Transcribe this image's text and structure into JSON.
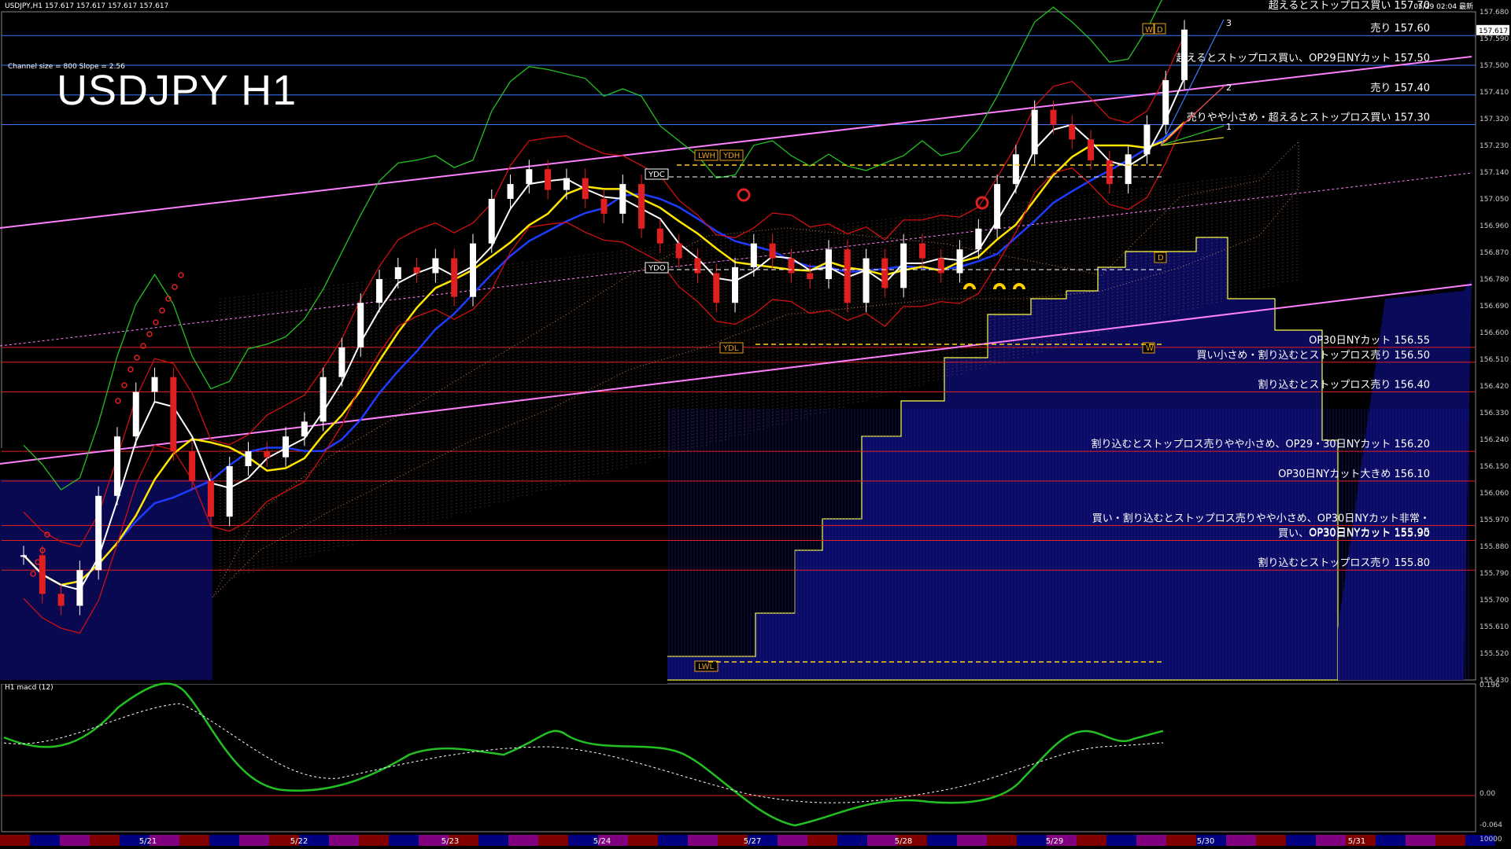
{
  "header": {
    "symbol_info": "USDJPY,H1  157.617 157.617 157.617 157.617",
    "channel_info": "Channel size = 800 Slope = 2.56",
    "title": "USDJPY H1",
    "corner_time": "05/29 02:04 最新"
  },
  "indicator": {
    "label": "H1  macd (12)"
  },
  "chart_data": {
    "type": "line",
    "title": "USDJPY H1",
    "price_axis": {
      "min": 155.43,
      "max": 157.68,
      "ticks": [
        "157.680",
        "157.590",
        "157.500",
        "157.410",
        "157.320",
        "157.230",
        "157.140",
        "157.050",
        "156.960",
        "156.870",
        "156.780",
        "156.690",
        "156.600",
        "156.510",
        "156.420",
        "156.330",
        "156.240",
        "156.150",
        "156.060",
        "155.970",
        "155.880",
        "155.790",
        "155.700",
        "155.610",
        "155.520",
        "155.430"
      ],
      "current_price": "157.617"
    },
    "date_axis": [
      "5/21",
      "5/22",
      "5/23",
      "5/24",
      "5/27",
      "5/28",
      "5/29",
      "5/30",
      "5/31"
    ],
    "price_series": [
      155.85,
      155.72,
      155.68,
      155.8,
      156.05,
      156.25,
      156.4,
      156.45,
      156.2,
      156.1,
      155.98,
      156.15,
      156.2,
      156.18,
      156.25,
      156.3,
      156.45,
      156.55,
      156.7,
      156.78,
      156.82,
      156.8,
      156.85,
      156.72,
      156.9,
      157.05,
      157.1,
      157.15,
      157.08,
      157.12,
      157.05,
      157.0,
      157.1,
      156.95,
      156.9,
      156.85,
      156.8,
      156.7,
      156.82,
      156.9,
      156.85,
      156.8,
      156.78,
      156.88,
      156.7,
      156.85,
      156.75,
      156.9,
      156.85,
      156.8,
      156.88,
      156.95,
      157.1,
      157.2,
      157.35,
      157.3,
      157.25,
      157.18,
      157.1,
      157.2,
      157.3,
      157.45,
      157.62
    ],
    "levels": [
      {
        "price": 157.6,
        "label": "売り 157.60",
        "color": "#3b78ff"
      },
      {
        "price": 157.5,
        "label": "超えるとストップロス買い、OP29日NYカット 157.50",
        "color": "#3b78ff"
      },
      {
        "price": 157.4,
        "label": "売り 157.40",
        "color": "#3b78ff"
      },
      {
        "price": 157.3,
        "label": "売りやや小さめ・超えるとストップロス買い 157.30",
        "color": "#3b78ff"
      },
      {
        "price": 156.55,
        "label": "OP30日NYカット 156.55",
        "color": "#e02020"
      },
      {
        "price": 156.5,
        "label": "買い小さめ・割り込むとストップロス売り 156.50",
        "color": "#e02020"
      },
      {
        "price": 156.4,
        "label": "割り込むとストップロス売り 156.40",
        "color": "#e02020"
      },
      {
        "price": 156.2,
        "label": "割り込むとストップロス売りやや小さめ、OP29・30日NYカット 156.20",
        "color": "#e02020"
      },
      {
        "price": 156.1,
        "label": "OP30日NYカット大きめ 156.10",
        "color": "#e02020"
      },
      {
        "price": 155.95,
        "label": "買い・割り込むとストップロス売りやや小さめ、OP30日NYカット非常・",
        "color": "#e02020"
      },
      {
        "price": 155.95,
        "label": "OP30日NYカット 155.95",
        "color": "#e02020"
      },
      {
        "price": 155.9,
        "label": "買い、OP30日NYカット 155.90",
        "color": "#e02020"
      },
      {
        "price": 155.8,
        "label": "割り込むとストップロス売り 155.80",
        "color": "#e02020"
      }
    ],
    "top_partial_label": "超えるとストップロス買い 157.70",
    "markers": [
      "LWH",
      "YDH",
      "YDC",
      "YDO",
      "YDL",
      "LWL",
      "W",
      "D"
    ],
    "fib_labels": [
      "3",
      "2",
      "1"
    ],
    "macd_axis": {
      "ticks": [
        "0.196",
        "0.00",
        "-0.064",
        "10000"
      ]
    },
    "colors": {
      "support": "#ff55ff",
      "trend": "#1e3cff",
      "ma_fast": "#ffffff",
      "ma_mid": "#ffe600",
      "boll": "#d01010",
      "cloud": "#e8a070",
      "channel": "#ff80ff"
    }
  }
}
